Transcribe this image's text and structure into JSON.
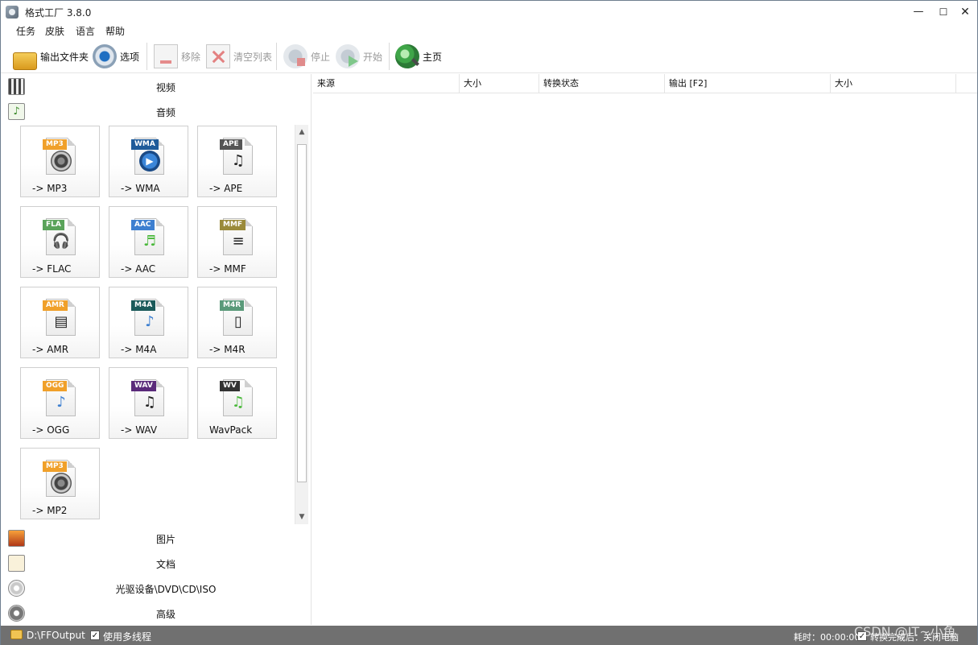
{
  "window": {
    "title": "格式工厂 3.8.0"
  },
  "menu": [
    "任务",
    "皮肤",
    "语言",
    "帮助"
  ],
  "toolbar": {
    "output_folder": "输出文件夹",
    "options": "选项",
    "remove": "移除",
    "clear_list": "清空列表",
    "stop": "停止",
    "start": "开始",
    "home": "主页"
  },
  "categories": {
    "video": "视频",
    "audio": "音频",
    "picture": "图片",
    "document": "文档",
    "disc": "光驱设备\\DVD\\CD\\ISO",
    "advanced": "高级"
  },
  "audio_formats": [
    {
      "label": "-> MP3",
      "badge": "MP3",
      "color": "#f0a02a",
      "icon": "speaker-icon"
    },
    {
      "label": "-> WMA",
      "badge": "WMA",
      "color": "#1f5b9a",
      "icon": "play-icon"
    },
    {
      "label": "-> APE",
      "badge": "APE",
      "color": "#555555",
      "icon": "guitar-icon"
    },
    {
      "label": "-> FLAC",
      "badge": "FLA",
      "color": "#5aa35a",
      "icon": "headphone-icon"
    },
    {
      "label": "-> AAC",
      "badge": "AAC",
      "color": "#3d7fd0",
      "icon": "speaker-note-icon"
    },
    {
      "label": "-> MMF",
      "badge": "MMF",
      "color": "#9a8a3a",
      "icon": "document-icon"
    },
    {
      "label": "-> AMR",
      "badge": "AMR",
      "color": "#f0a02a",
      "icon": "scanner-icon"
    },
    {
      "label": "-> M4A",
      "badge": "M4A",
      "color": "#1b5a5a",
      "icon": "disc-note-icon"
    },
    {
      "label": "-> M4R",
      "badge": "M4R",
      "color": "#5a9a7a",
      "icon": "phone-icon"
    },
    {
      "label": "-> OGG",
      "badge": "OGG",
      "color": "#f0a02a",
      "icon": "note-icon"
    },
    {
      "label": "-> WAV",
      "badge": "WAV",
      "color": "#5a2a7a",
      "icon": "notes-icon"
    },
    {
      "label": "WavPack",
      "badge": "WV",
      "color": "#333333",
      "icon": "green-note-icon"
    },
    {
      "label": "-> MP2",
      "badge": "MP3",
      "color": "#f0a02a",
      "icon": "speaker-icon"
    }
  ],
  "columns": [
    "来源",
    "大小",
    "转换状态",
    "输出 [F2]",
    "大小"
  ],
  "status": {
    "output_path": "D:\\FFOutput",
    "multithread": "使用多线程",
    "elapsed": "耗时：00:00:00",
    "after_convert": "转换完成后：关闭电脑"
  },
  "watermark": "CSDN @IT~小鱼"
}
